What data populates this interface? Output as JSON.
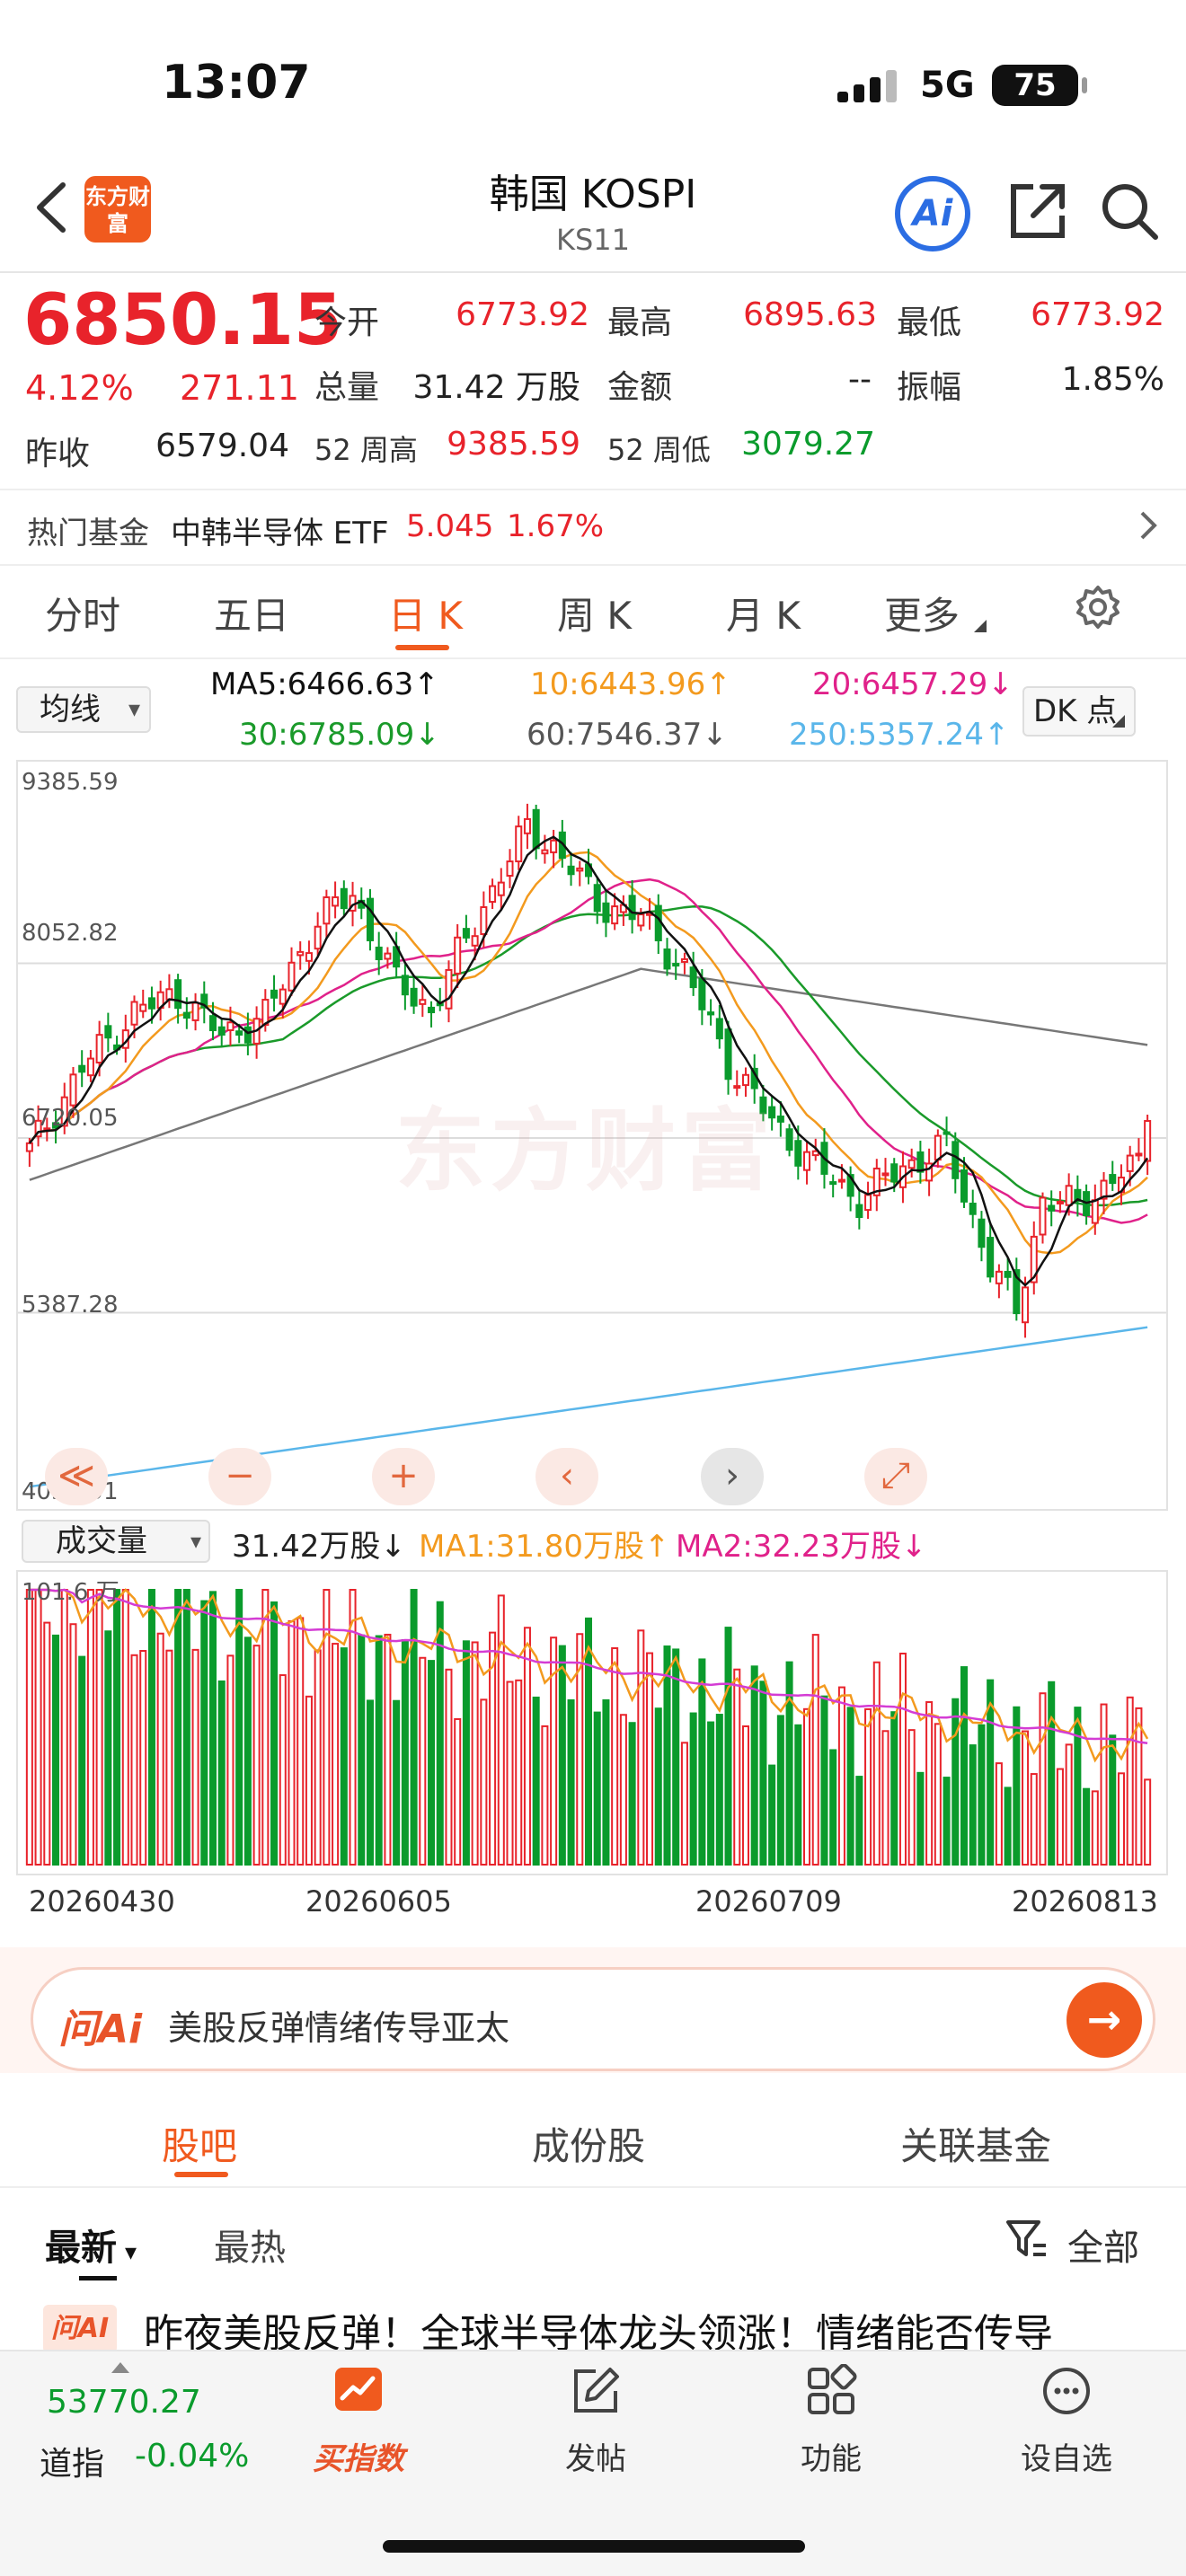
{
  "status": {
    "time": "13:07",
    "network": "5G",
    "battery": "75"
  },
  "header": {
    "logo_text": "东方财富",
    "title": "韩国 KOSPI",
    "subtitle": "KS11",
    "ai_label": "Ai"
  },
  "quote": {
    "price": "6850.15",
    "change_pct": "4.12%",
    "change": "271.11",
    "prev_close_label": "昨收",
    "prev_close": "6579.04",
    "open_label": "今开",
    "open": "6773.92",
    "high_label": "最高",
    "high": "6895.63",
    "low_label": "最低",
    "low": "6773.92",
    "volume_label": "总量",
    "volume": "31.42 万股",
    "amount_label": "金额",
    "amount": "--",
    "amplitude_label": "振幅",
    "amplitude": "1.85%",
    "wk52_high_label": "52 周高",
    "wk52_high": "9385.59",
    "wk52_low_label": "52 周低",
    "wk52_low": "3079.27"
  },
  "fund": {
    "label": "热门基金",
    "name": "中韩半导体 ETF",
    "price": "5.045",
    "pct": "1.67%"
  },
  "kline_tabs": [
    "分时",
    "五日",
    "日 K",
    "周 K",
    "月 K",
    "更多"
  ],
  "ma": {
    "select": "均线",
    "ma5": "MA5:6466.63↑",
    "ma10": "10:6443.96↑",
    "ma20": "20:6457.29↓",
    "ma30": "30:6785.09↓",
    "ma60": "60:7546.37↓",
    "ma250": "250:5357.24↑",
    "dk": "DK 点",
    "colors": {
      "ma5": "#111111",
      "ma10": "#f39a1e",
      "ma20": "#e0218a",
      "ma30": "#1a9a2a",
      "ma60": "#777777",
      "ma250": "#5ab6ea"
    }
  },
  "chart": {
    "yticks": [
      "9385.59",
      "8052.82",
      "6720.05",
      "5387.28",
      "4054.51"
    ],
    "watermark": "东方财富",
    "controls": [
      "≪",
      "−",
      "+",
      "‹",
      "›",
      "⤢"
    ]
  },
  "volume": {
    "select": "成交量",
    "vol": "31.42万股↓",
    "ma1": "MA1:31.80万股↑",
    "ma2": "MA2:32.23万股↓",
    "ymax": "101.6 万"
  },
  "chart_data": {
    "type": "candlestick",
    "x_axis_labels": [
      "20260430",
      "20260605",
      "20260709",
      "20260813"
    ],
    "ylim": [
      4054.51,
      9385.59
    ],
    "last_close": 6850.15,
    "volume_unit": "万股",
    "volume_max": 101.6,
    "volume_last": 31.42,
    "ma_last": {
      "MA5": 6466.63,
      "MA10": 6443.96,
      "MA20": 6457.29,
      "MA30": 6785.09,
      "MA60": 7546.37,
      "MA250": 5357.24
    }
  },
  "ai": {
    "label": "问Ai",
    "query": "美股反弹情绪传导亚太"
  },
  "section_tabs": [
    "股吧",
    "成份股",
    "关联基金"
  ],
  "sort": {
    "latest": "最新",
    "hot": "最热",
    "filter": "全部"
  },
  "post": {
    "badge": "问AI",
    "title": "昨夜美股反弹！全球半导体龙头领涨！情绪能否传导"
  },
  "bottom_nav": {
    "index_value": "53770.27",
    "index_name": "道指",
    "index_pct": "-0.04%",
    "items": [
      "买指数",
      "发帖",
      "功能",
      "设自选"
    ]
  }
}
